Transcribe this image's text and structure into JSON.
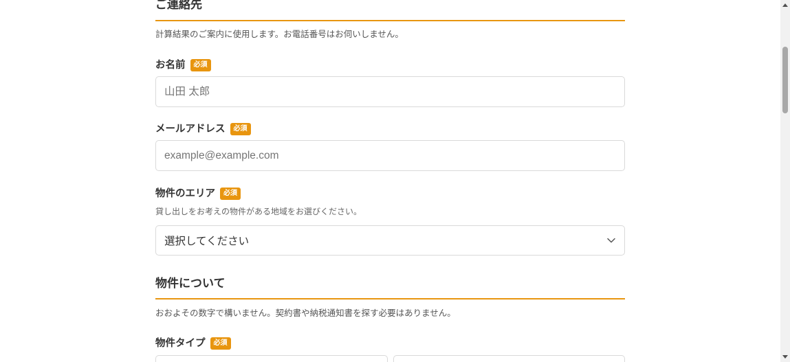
{
  "contact_section": {
    "title": "ご連絡先",
    "description": "計算結果のご案内に使用します。お電話番号はお伺いしません。"
  },
  "fields": {
    "name": {
      "label": "お名前",
      "badge": "必須",
      "placeholder": "山田 太郎",
      "value": ""
    },
    "email": {
      "label": "メールアドレス",
      "badge": "必須",
      "placeholder": "example@example.com",
      "value": ""
    },
    "area": {
      "label": "物件のエリア",
      "badge": "必須",
      "hint": "貸し出しをお考えの物件がある地域をお選びください。",
      "selected": "選択してください"
    },
    "property_type": {
      "label": "物件タイプ",
      "badge": "必須"
    }
  },
  "property_section": {
    "title": "物件について",
    "description": "おおよその数字で構いません。契約書や納税通知書を探す必要はありません。"
  },
  "colors": {
    "accent": "#e8950f",
    "border": "#d9d9d9",
    "text": "#333333"
  },
  "icons": {
    "select_chevron": "chevron-down-icon",
    "scroll_up": "scroll-up-arrow-icon",
    "scroll_down": "scroll-down-arrow-icon"
  }
}
